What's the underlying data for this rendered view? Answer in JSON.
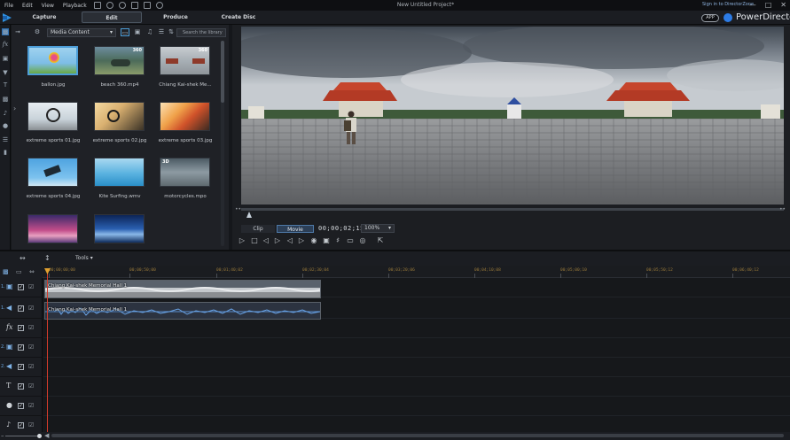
{
  "menu": {
    "items": [
      "File",
      "Edit",
      "View",
      "Playback"
    ],
    "window_title": "New Untitled Project*"
  },
  "modes": {
    "tabs": [
      {
        "label": "Capture"
      },
      {
        "label": "Edit"
      },
      {
        "label": "Produce"
      },
      {
        "label": "Create Disc"
      }
    ],
    "signin": "Sign in to DirectorZone",
    "app_badge": "APP",
    "brand": "PowerDirector"
  },
  "library": {
    "dropdown": "Media Content",
    "search_placeholder": "Search the library",
    "items": [
      {
        "label": "ballon.jpg",
        "badge": ""
      },
      {
        "label": "beach 360.mp4",
        "badge": "360"
      },
      {
        "label": "Chiang Kai-shek Me...",
        "badge": "360"
      },
      {
        "label": "extreme sports 01.jpg",
        "badge": ""
      },
      {
        "label": "extreme sports 02.jpg",
        "badge": ""
      },
      {
        "label": "extreme sports 03.jpg",
        "badge": ""
      },
      {
        "label": "extreme sports 04.jpg",
        "badge": ""
      },
      {
        "label": "Kite Surfing.wmv",
        "badge": ""
      },
      {
        "label": "motorcycles.mpo",
        "badge": "3D"
      },
      {
        "label": "",
        "badge": ""
      },
      {
        "label": "",
        "badge": ""
      }
    ]
  },
  "preview": {
    "clip_label": "Clip",
    "movie_label": "Movie",
    "timecode": "00;00;02;15",
    "zoom": "100%"
  },
  "timeline": {
    "tools_label": "Tools",
    "ruler": [
      "00;00;00;00",
      "00;00;50;00",
      "00;01;40;02",
      "00;02;30;04",
      "00;03;20;06",
      "00;04;10;08",
      "00;05;00;10",
      "00;05;50;12",
      "00;06;40;12"
    ],
    "tracks": [
      {
        "num": "1.",
        "icon": "video-track-icon"
      },
      {
        "num": "1.",
        "icon": "audio-track-icon"
      },
      {
        "num": "",
        "icon": "fx-track-icon"
      },
      {
        "num": "2.",
        "icon": "video-track-icon"
      },
      {
        "num": "2.",
        "icon": "audio-track-icon"
      },
      {
        "num": "",
        "icon": "title-track-icon"
      },
      {
        "num": "",
        "icon": "voice-track-icon"
      },
      {
        "num": "",
        "icon": "music-track-icon"
      }
    ],
    "video_clip_label": "Chiang Kai-shek Memorial Hall 1",
    "audio_clip_label": "Chiang Kai-shek Memorial Hall 1"
  },
  "colors": {
    "accent": "#4d9ed8",
    "playhead": "#d23b2b",
    "brand": "#2c7be5"
  }
}
